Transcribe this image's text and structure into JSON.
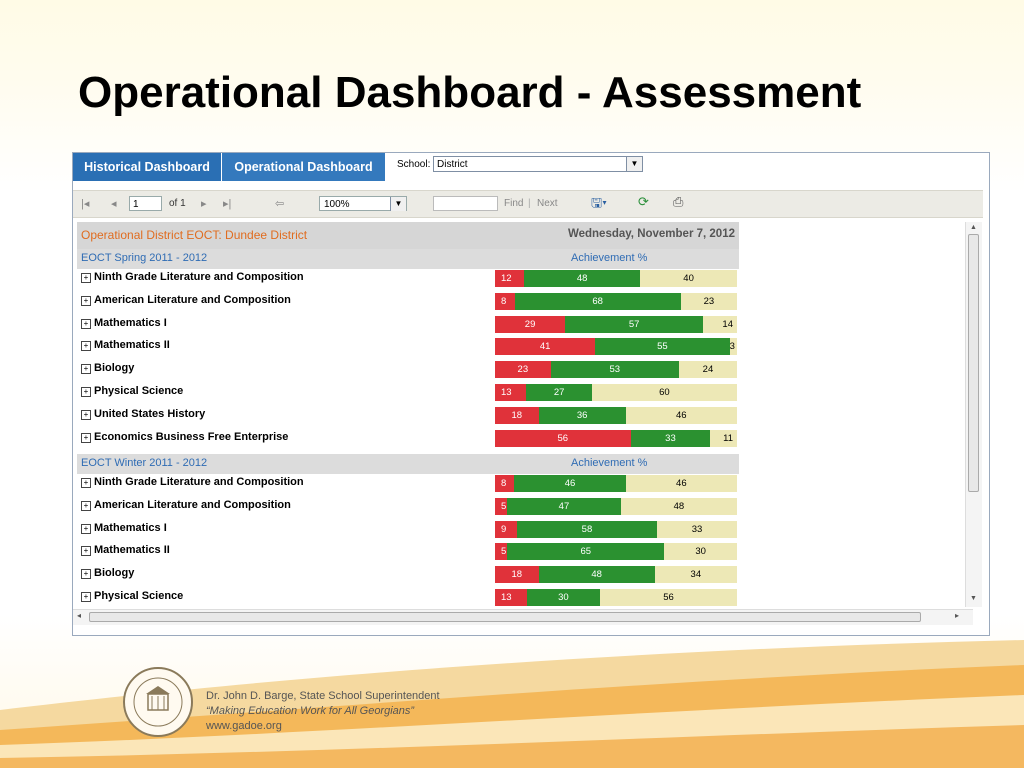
{
  "page_title": "Operational Dashboard - Assessment",
  "tabs": [
    {
      "label": "Historical Dashboard"
    },
    {
      "label": "Operational Dashboard"
    }
  ],
  "school": {
    "label": "School:",
    "value": "District"
  },
  "toolbar": {
    "page_value": "1",
    "page_of": "of 1",
    "zoom": "100%",
    "find_label": "Find",
    "next_label": "Next"
  },
  "report": {
    "title": "Operational District EOCT: Dundee District",
    "date": "Wednesday, November 7, 2012"
  },
  "sections": [
    {
      "title": "EOCT  Spring  2011 - 2012",
      "achievement_label": "Achievement %",
      "rows": [
        {
          "label": "Ninth Grade Literature and Composition",
          "red": 12,
          "green": 48,
          "tan": 40
        },
        {
          "label": "American Literature and Composition",
          "red": 8,
          "green": 68,
          "tan": 23
        },
        {
          "label": "Mathematics I",
          "red": 29,
          "green": 57,
          "tan": 14
        },
        {
          "label": "Mathematics II",
          "red": 41,
          "green": 55,
          "tan": 3
        },
        {
          "label": "Biology",
          "red": 23,
          "green": 53,
          "tan": 24
        },
        {
          "label": "Physical Science",
          "red": 13,
          "green": 27,
          "tan": 60
        },
        {
          "label": "United States History",
          "red": 18,
          "green": 36,
          "tan": 46
        },
        {
          "label": "Economics Business Free Enterprise",
          "red": 56,
          "green": 33,
          "tan": 11
        }
      ]
    },
    {
      "title": "EOCT  Winter  2011 - 2012",
      "achievement_label": "Achievement %",
      "rows": [
        {
          "label": "Ninth Grade Literature and Composition",
          "red": 8,
          "green": 46,
          "tan": 46
        },
        {
          "label": "American Literature and Composition",
          "red": 5,
          "green": 47,
          "tan": 48
        },
        {
          "label": "Mathematics I",
          "red": 9,
          "green": 58,
          "tan": 33
        },
        {
          "label": "Mathematics II",
          "red": 5,
          "green": 65,
          "tan": 30
        },
        {
          "label": "Biology",
          "red": 18,
          "green": 48,
          "tan": 34
        },
        {
          "label": "Physical Science",
          "red": 13,
          "green": 30,
          "tan": 56
        }
      ]
    }
  ],
  "colors": {
    "red": "#e0323a",
    "green": "#2b9130",
    "tan": "#ede8b6",
    "tab": "#2a6fb4",
    "report_title": "#e06c1f",
    "section_title": "#2f6cb4"
  },
  "footer": {
    "line1": "Dr. John D. Barge, State School Superintendent",
    "line2": "“Making Education Work for All Georgians”",
    "line3": "www.gadoe.org",
    "seal_text": "DEPARTMENT OF EDUCATION"
  }
}
